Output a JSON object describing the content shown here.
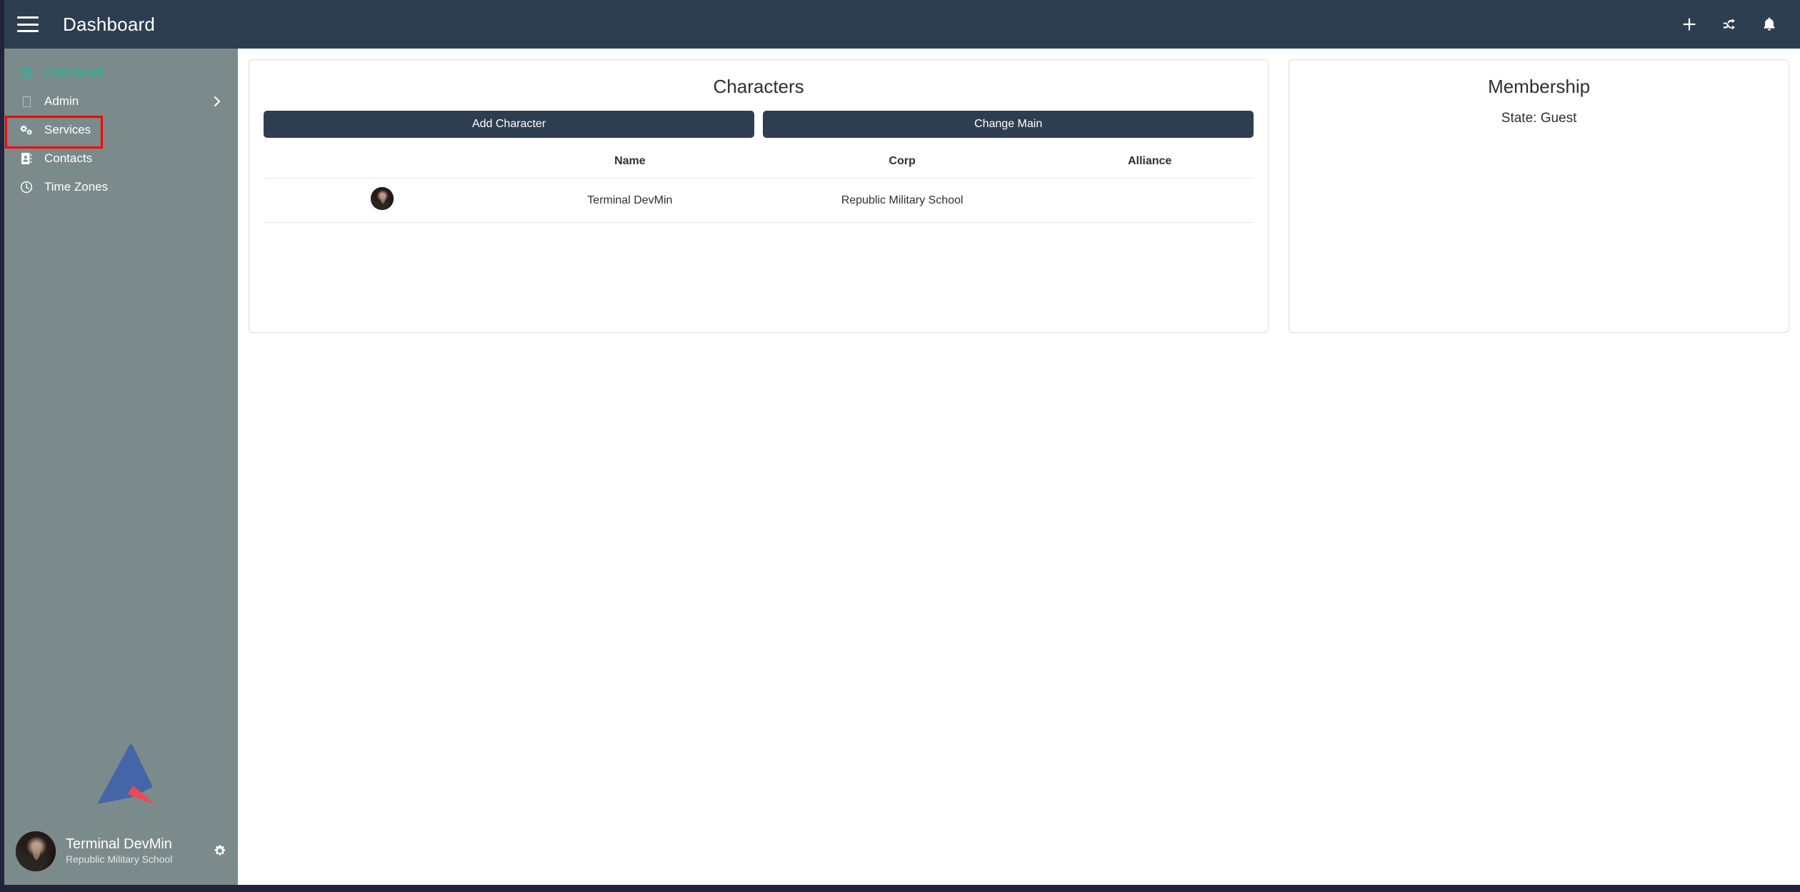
{
  "topbar": {
    "title": "Dashboard",
    "menu_icon": "hamburger-icon",
    "actions": [
      {
        "name": "add-icon",
        "glyph": "plus"
      },
      {
        "name": "shuffle-icon",
        "glyph": "shuffle"
      },
      {
        "name": "notifications-icon",
        "glyph": "bell"
      }
    ]
  },
  "sidebar": {
    "items": [
      {
        "label": "Dashboard",
        "icon": "dashboard-icon",
        "active": true,
        "highlighted": false,
        "has_chevron": false
      },
      {
        "label": "Admin",
        "icon": "missing-glyph-icon",
        "active": false,
        "highlighted": false,
        "has_chevron": true
      },
      {
        "label": "Services",
        "icon": "cogs-icon",
        "active": false,
        "highlighted": true,
        "has_chevron": false
      },
      {
        "label": "Contacts",
        "icon": "address-book-icon",
        "active": false,
        "highlighted": false,
        "has_chevron": false
      },
      {
        "label": "Time Zones",
        "icon": "clock-icon",
        "active": false,
        "highlighted": false,
        "has_chevron": false
      }
    ],
    "logo": "brand-logo",
    "profile": {
      "name": "Terminal DevMin",
      "corp": "Republic Military School",
      "settings_icon": "gear-icon"
    }
  },
  "main": {
    "characters_card": {
      "title": "Characters",
      "buttons": {
        "add": "Add Character",
        "change_main": "Change Main"
      },
      "columns": [
        "",
        "Name",
        "Corp",
        "Alliance"
      ],
      "rows": [
        {
          "avatar": "character-portrait",
          "name": "Terminal DevMin",
          "corp": "Republic Military School",
          "alliance": ""
        }
      ]
    },
    "membership_card": {
      "title": "Membership",
      "state": "State: Guest"
    }
  },
  "colors": {
    "topbar": "#2d3e50",
    "sidebar": "#7b8b8b",
    "accent_active": "#18bc9c",
    "button": "#2d3e50",
    "highlight_box": "#ff0000",
    "page_border": "#23243b"
  }
}
